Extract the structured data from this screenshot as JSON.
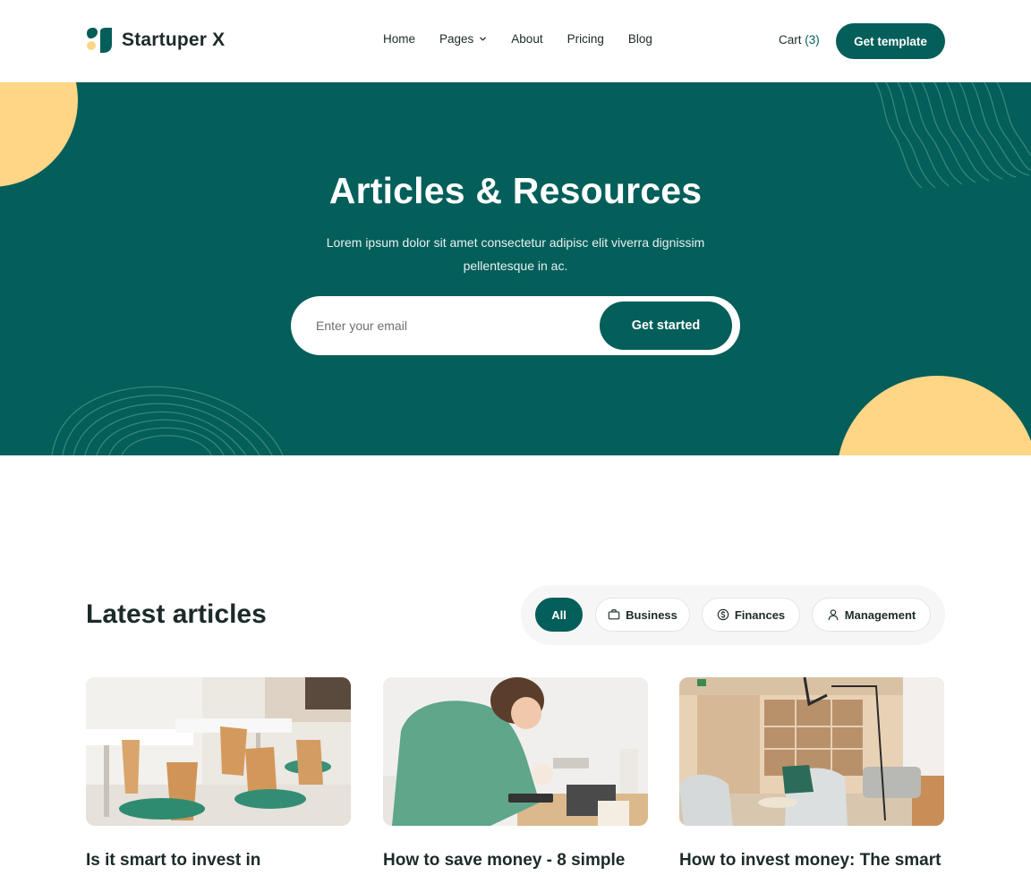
{
  "brand": {
    "name": "Startuper X"
  },
  "nav": {
    "items": [
      {
        "label": "Home"
      },
      {
        "label": "Pages",
        "icon": "chevron-down-icon"
      },
      {
        "label": "About"
      },
      {
        "label": "Pricing"
      },
      {
        "label": "Blog"
      }
    ],
    "cart_label": "Cart",
    "cart_count": "(3)",
    "cta_label": "Get template"
  },
  "hero": {
    "title": "Articles & Resources",
    "subtitle": "Lorem ipsum dolor sit amet consectetur adipisc elit viverra dignissim pellentesque in ac.",
    "email_placeholder": "Enter your email",
    "cta_label": "Get started"
  },
  "articles": {
    "heading": "Latest articles",
    "filters": [
      {
        "label": "All",
        "active": true
      },
      {
        "label": "Business",
        "icon": "briefcase-icon"
      },
      {
        "label": "Finances",
        "icon": "dollar-circle-icon"
      },
      {
        "label": "Management",
        "icon": "user-icon"
      }
    ],
    "cards": [
      {
        "title": "Is it smart to invest in"
      },
      {
        "title": "How to save money - 8 simple"
      },
      {
        "title": "How to invest money: The smart"
      }
    ]
  },
  "colors": {
    "primary": "#045e5a",
    "accent": "#fed685",
    "text": "#1d2a2a"
  }
}
